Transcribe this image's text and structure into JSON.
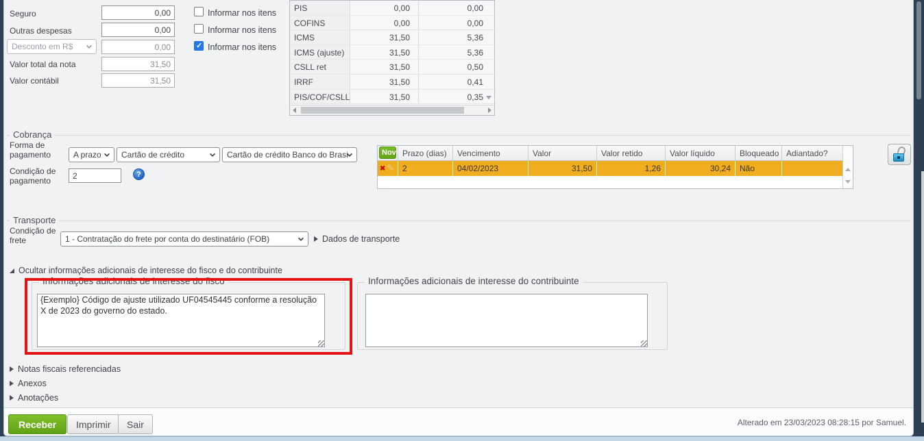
{
  "colors": {
    "page_bg": "#2e4154",
    "accent_green": "#6fb41e",
    "row_highlight_orange": "#f0ad1f",
    "highlight_red": "#e51313",
    "checked_blue": "#2379e9"
  },
  "totals": {
    "rows": [
      {
        "label": "Seguro",
        "value": "0,00"
      },
      {
        "label": "Outras despesas",
        "value": "0,00"
      },
      {
        "label": "Desconto em R$",
        "value": "0,00"
      },
      {
        "label": "Valor total da nota",
        "value": "31,50"
      },
      {
        "label": "Valor contábil",
        "value": "31,50"
      }
    ],
    "checkboxes": [
      {
        "label": "Informar nos itens",
        "checked": false
      },
      {
        "label": "Informar nos itens",
        "checked": false
      },
      {
        "label": "Informar nos itens",
        "checked": true
      }
    ],
    "tax_table": {
      "rows": [
        {
          "name": "PIS",
          "base": "0,00",
          "value": "0,00"
        },
        {
          "name": "COFINS",
          "base": "0,00",
          "value": "0,00"
        },
        {
          "name": "ICMS",
          "base": "31,50",
          "value": "5,36"
        },
        {
          "name": "ICMS (ajuste)",
          "base": "31,50",
          "value": "5,36"
        },
        {
          "name": "CSLL ret",
          "base": "31,50",
          "value": "0,50"
        },
        {
          "name": "IRRF",
          "base": "31,50",
          "value": "0,41"
        },
        {
          "name": "PIS/COF/CSLL...",
          "base": "31,50",
          "value": "0,35"
        }
      ]
    }
  },
  "cobranca": {
    "legend": "Cobrança",
    "forma_pagamento_label": "Forma de pagamento",
    "forma_selects": [
      "A prazo",
      "Cartão de crédito",
      "Cartão de crédito Banco do Brasi"
    ],
    "condicao_pagamento_label": "Condição de pagamento",
    "condicao_pagamento_value": "2",
    "help_icon_glyph": "?",
    "parcelas_table": {
      "new_button_label": "Novo",
      "headers": [
        "Prazo (dias)",
        "Vencimento",
        "Valor",
        "Valor retido",
        "Valor líquido",
        "Bloqueado",
        "Adiantado?"
      ],
      "rows": [
        {
          "prazo": "2",
          "vencimento": "04/02/2023",
          "valor": "31,50",
          "valor_retido": "1,26",
          "valor_liquido": "30,24",
          "bloqueado": "Não",
          "adiantado": ""
        }
      ],
      "delete_icon_glyph": "✖",
      "edit_icon_glyph": "✎"
    }
  },
  "transporte": {
    "legend": "Transporte",
    "condicao_frete_label": "Condição de frete",
    "condicao_frete_value": "1 - Contratação do frete por conta do destinatário (FOB)",
    "dados_transporte_label": "Dados de transporte"
  },
  "informacoes": {
    "toggle_label": "Ocultar informações adicionais de interesse do fisco e do contribuinte",
    "fisco": {
      "legend": "Informações adicionais de interesse do fisco",
      "value": "{Exemplo} Código de ajuste utilizado UF04545445 conforme a resolução X de 2023 do governo do estado."
    },
    "contribuinte": {
      "legend": "Informações adicionais de interesse do contribuinte",
      "value": ""
    }
  },
  "disclosures": [
    {
      "label": "Notas fiscais referenciadas"
    },
    {
      "label": "Anexos"
    },
    {
      "label": "Anotações"
    }
  ],
  "footer": {
    "receber_label": "Receber",
    "imprimir_label": "Imprimir",
    "sair_label": "Sair",
    "status_text": "Alterado em 23/03/2023 08:28:15 por Samuel."
  }
}
